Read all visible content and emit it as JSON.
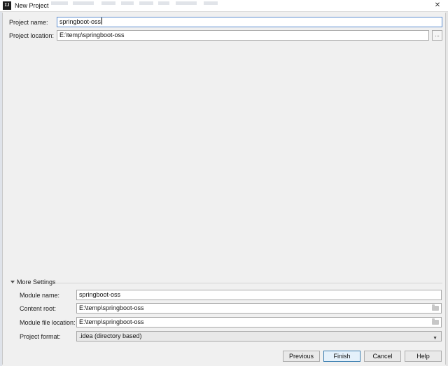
{
  "window": {
    "title": "New Project",
    "app_icon_text": "IJ",
    "close_symbol": "✕"
  },
  "project": {
    "name_label": "Project name:",
    "name_value": "springboot-oss",
    "location_label": "Project location:",
    "location_value": "E:\\temp\\springboot-oss",
    "browse_label": "..."
  },
  "more_settings": {
    "label": "More Settings",
    "module_name_label": "Module name:",
    "module_name_value": "springboot-oss",
    "content_root_label": "Content root:",
    "content_root_value": "E:\\temp\\springboot-oss",
    "module_file_label": "Module file location:",
    "module_file_value": "E:\\temp\\springboot-oss",
    "format_label": "Project format:",
    "format_value": ".idea (directory based)"
  },
  "buttons": {
    "previous": "Previous",
    "finish": "Finish",
    "cancel": "Cancel",
    "help": "Help"
  },
  "icons": {
    "folder": "folder-icon",
    "dropdown": "chevron-down-icon",
    "expand": "triangle-down-icon"
  }
}
